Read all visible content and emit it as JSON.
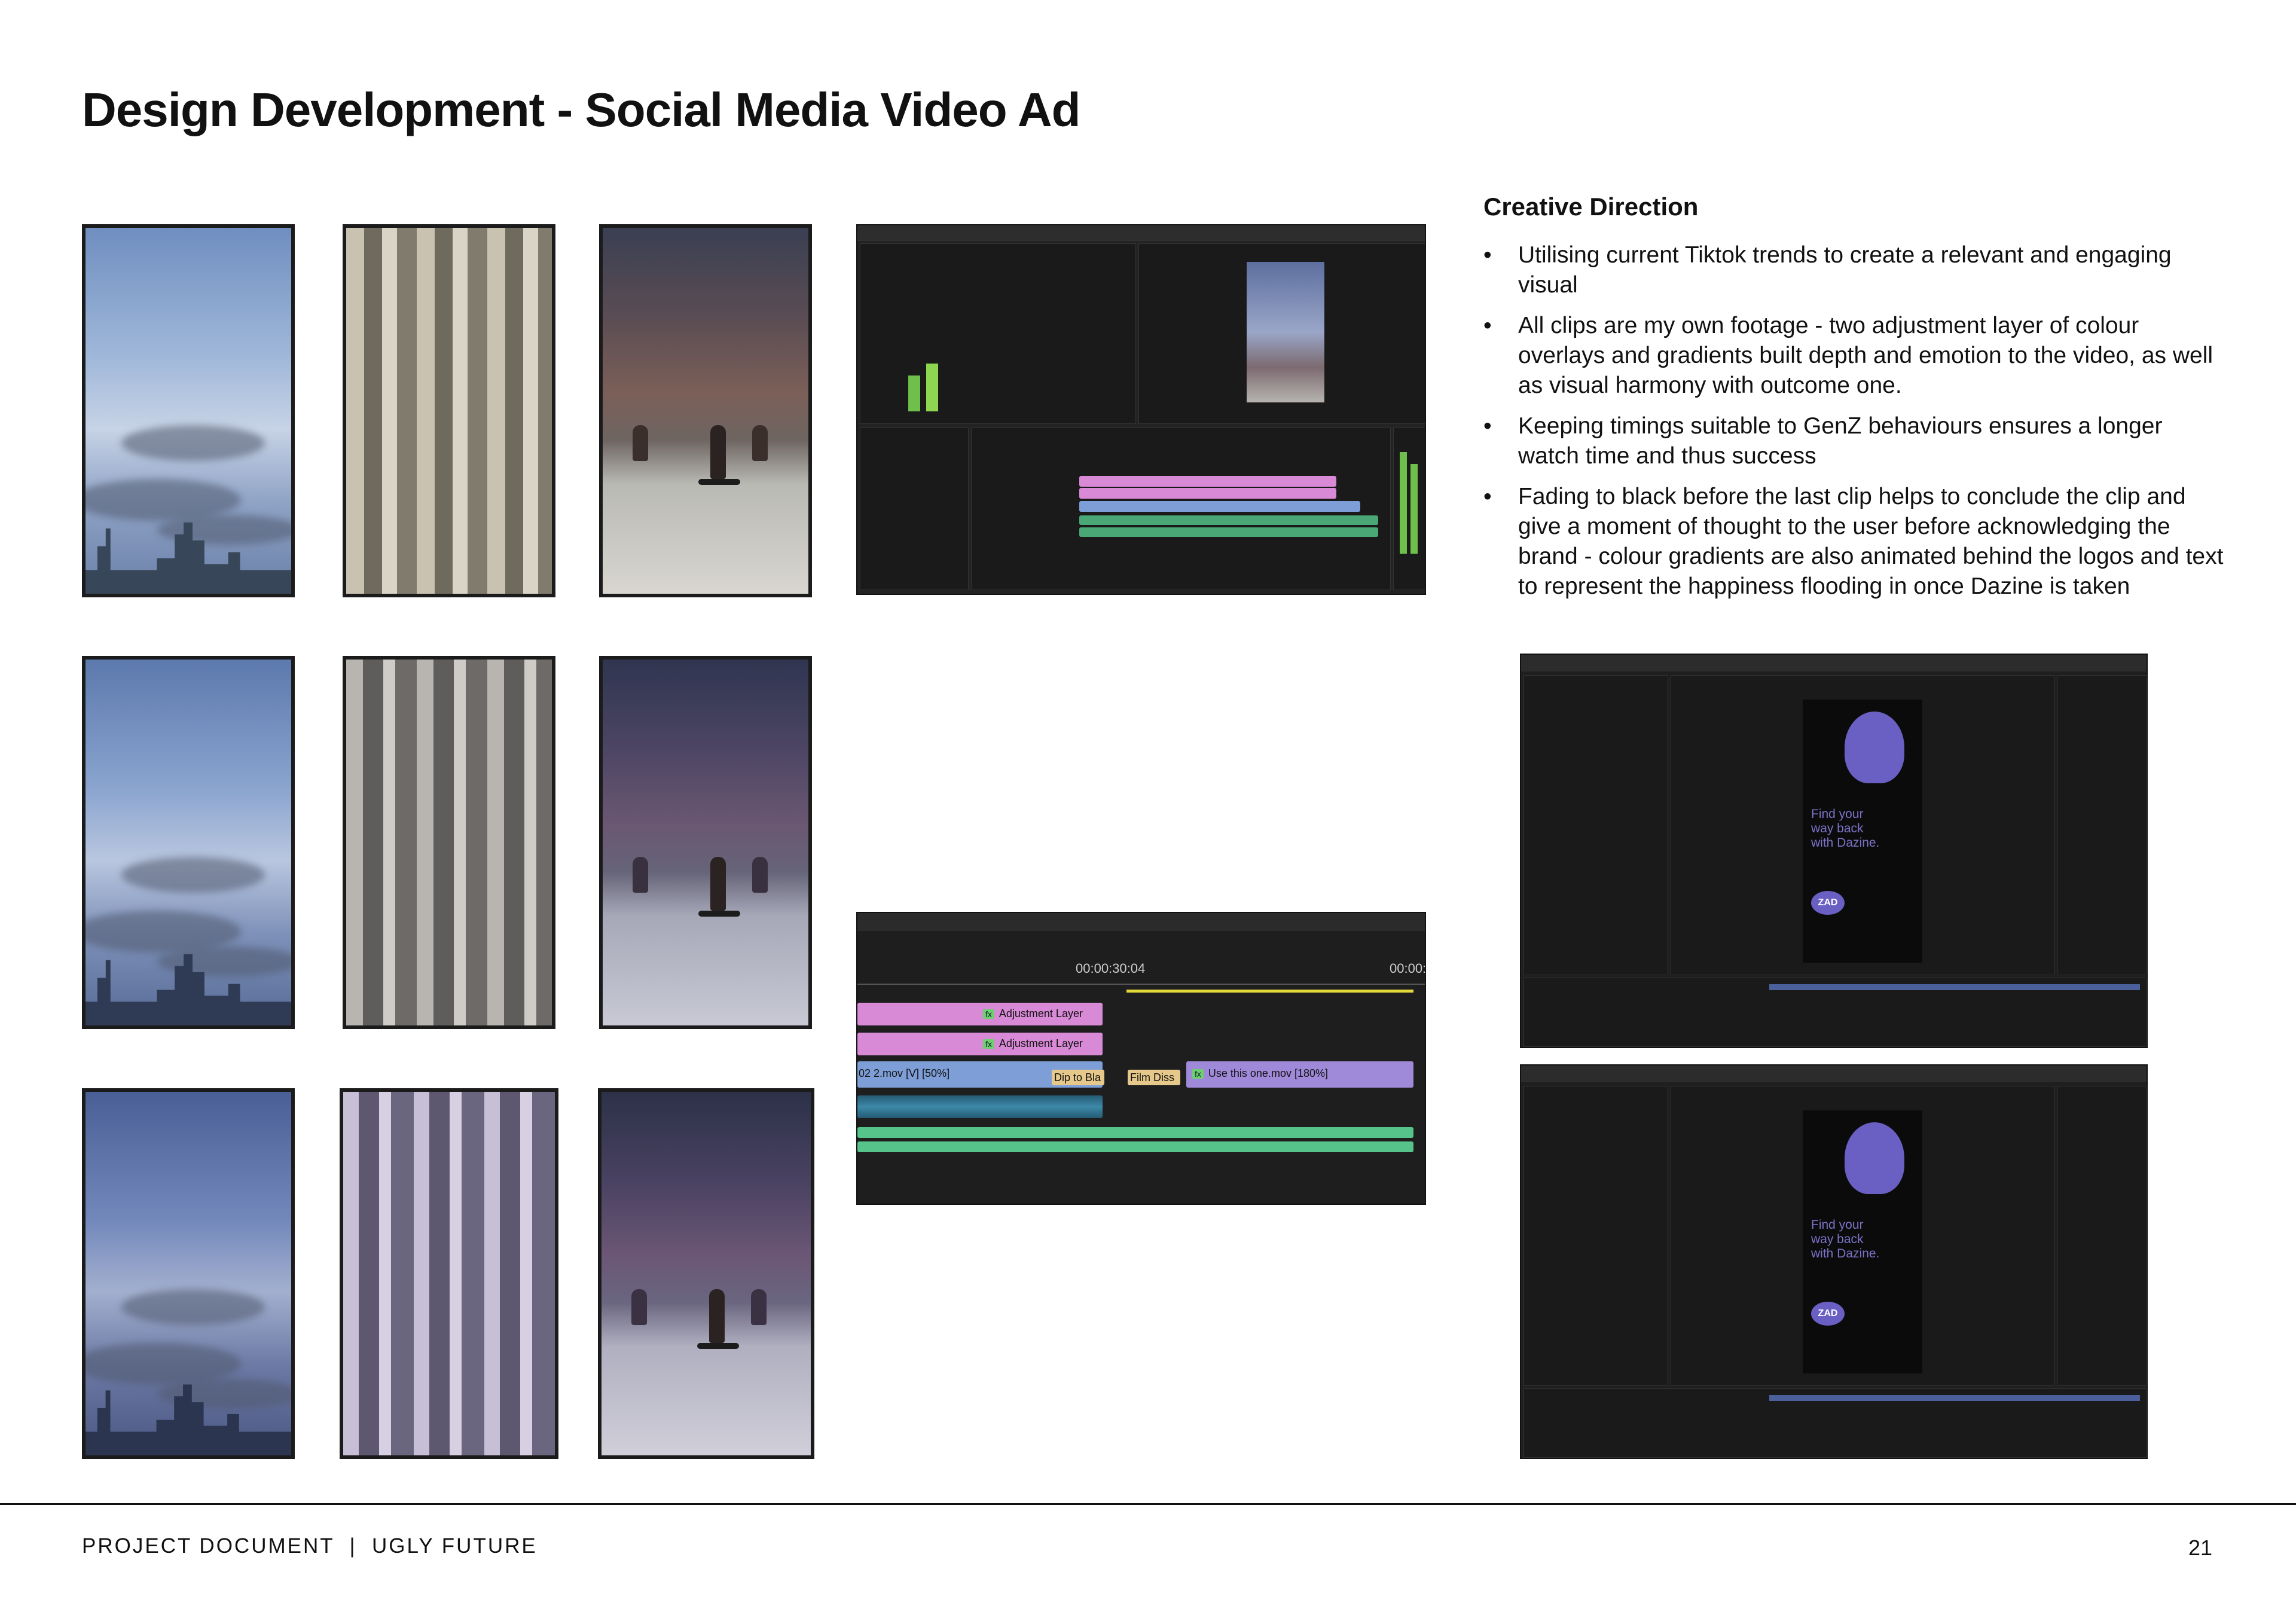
{
  "title": "Design Development - Social Media Video Ad",
  "creative_direction": {
    "heading": "Creative Direction",
    "points": [
      "Utilising current Tiktok trends to create a relevant and engaging visual",
      "All clips are my own footage - two adjustment layer of colour overlays and gradients built depth and emotion to the video, as well as visual harmony with outcome one.",
      "Keeping timings suitable to GenZ behaviours ensures a longer watch time and thus success",
      "Fading to black before the last clip helps to conclude the clip and give a moment of thought to the user before acknowledging the brand - colour gradients are also animated behind the logos and text to represent the happiness flooding in once Dazine is taken"
    ]
  },
  "timeline_zoom": {
    "timecode": "00:00:30:04",
    "timecode_next": "00:00:",
    "layer1": "Adjustment Layer",
    "layer2": "Adjustment Layer",
    "clip_left": "02 2.mov [V] [50%]",
    "transition1": "Dip to Bla",
    "transition2": "Film Diss",
    "clip_right": "Use this one.mov [180%]",
    "fx_label": "fx"
  },
  "ae_overlay": {
    "tagline": "Find your\nway back\nwith Dazine.",
    "logo": "ZAD"
  },
  "footer": {
    "left": "PROJECT DOCUMENT  |  UGLY FUTURE",
    "page": "21"
  }
}
